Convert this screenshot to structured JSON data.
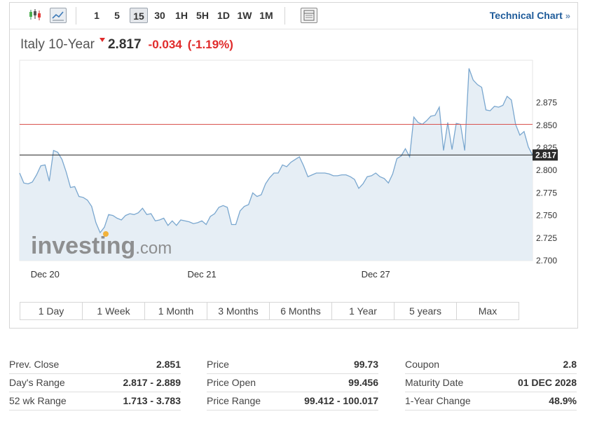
{
  "toolbar": {
    "icons": [
      {
        "name": "candlestick-icon",
        "active": false
      },
      {
        "name": "line-chart-icon",
        "active": true
      }
    ],
    "intervals": [
      {
        "label": "1",
        "active": false
      },
      {
        "label": "5",
        "active": false
      },
      {
        "label": "15",
        "active": true
      },
      {
        "label": "30",
        "active": false
      },
      {
        "label": "1H",
        "active": false
      },
      {
        "label": "5H",
        "active": false
      },
      {
        "label": "1D",
        "active": false
      },
      {
        "label": "1W",
        "active": false
      },
      {
        "label": "1M",
        "active": false
      }
    ],
    "table_icon": "table-icon",
    "technical_chart": "Technical Chart",
    "technical_chev": "»"
  },
  "header": {
    "instrument": "Italy 10-Year",
    "price": "2.817",
    "change": "-0.034",
    "change_pct": "(-1.19%)",
    "direction": "down"
  },
  "colors": {
    "line": "#7aa7cf",
    "area": "#e6eef5",
    "prev_close_line": "#d9534f",
    "current_line": "#222222",
    "negative": "#e02b2b",
    "link": "#1e5b9a"
  },
  "chart_data": {
    "type": "area",
    "y_ticks": [
      2.7,
      2.725,
      2.75,
      2.775,
      2.8,
      2.825,
      2.85,
      2.875
    ],
    "y_tick_labels": [
      "2.700",
      "2.725",
      "2.750",
      "2.775",
      "2.800",
      "2.825",
      "2.850",
      "2.875"
    ],
    "ylim": [
      2.7,
      2.922
    ],
    "x_labels": [
      {
        "label": "Dec 20",
        "index": 6
      },
      {
        "label": "Dec 21",
        "index": 43
      },
      {
        "label": "Dec 27",
        "index": 84
      }
    ],
    "prev_close": 2.851,
    "current": 2.817,
    "current_label": "2.817",
    "values": [
      2.797,
      2.786,
      2.785,
      2.787,
      2.795,
      2.805,
      2.806,
      2.788,
      2.822,
      2.82,
      2.812,
      2.798,
      2.781,
      2.782,
      2.771,
      2.77,
      2.767,
      2.76,
      2.742,
      2.731,
      2.737,
      2.751,
      2.75,
      2.747,
      2.745,
      2.75,
      2.752,
      2.751,
      2.753,
      2.758,
      2.751,
      2.752,
      2.744,
      2.745,
      2.747,
      2.739,
      2.744,
      2.739,
      2.745,
      2.744,
      2.743,
      2.741,
      2.742,
      2.744,
      2.74,
      2.749,
      2.752,
      2.759,
      2.761,
      2.759,
      2.74,
      2.74,
      2.755,
      2.76,
      2.762,
      2.775,
      2.771,
      2.773,
      2.785,
      2.792,
      2.797,
      2.797,
      2.806,
      2.804,
      2.809,
      2.812,
      2.815,
      2.805,
      2.793,
      2.795,
      2.797,
      2.797,
      2.797,
      2.796,
      2.794,
      2.794,
      2.795,
      2.795,
      2.793,
      2.79,
      2.78,
      2.785,
      2.793,
      2.794,
      2.797,
      2.793,
      2.791,
      2.786,
      2.796,
      2.813,
      2.816,
      2.824,
      2.815,
      2.859,
      2.853,
      2.851,
      2.855,
      2.86,
      2.861,
      2.87,
      2.822,
      2.853,
      2.823,
      2.852,
      2.851,
      2.822,
      2.913,
      2.9,
      2.895,
      2.892,
      2.867,
      2.866,
      2.871,
      2.87,
      2.872,
      2.882,
      2.878,
      2.851,
      2.839,
      2.843,
      2.826,
      2.817
    ]
  },
  "watermark": {
    "brand": "investing",
    "suffix": ".com"
  },
  "ranges": [
    "1 Day",
    "1 Week",
    "1 Month",
    "3 Months",
    "6 Months",
    "1 Year",
    "5 years",
    "Max"
  ],
  "stats": [
    [
      {
        "label": "Prev. Close",
        "value": "2.851"
      },
      {
        "label": "Day's Range",
        "value": "2.817 - 2.889"
      },
      {
        "label": "52 wk Range",
        "value": "1.713 - 3.783"
      }
    ],
    [
      {
        "label": "Price",
        "value": "99.73"
      },
      {
        "label": "Price Open",
        "value": "99.456"
      },
      {
        "label": "Price Range",
        "value": "99.412 - 100.017"
      }
    ],
    [
      {
        "label": "Coupon",
        "value": "2.8"
      },
      {
        "label": "Maturity Date",
        "value": "01 DEC 2028"
      },
      {
        "label": "1-Year Change",
        "value": "48.9%"
      }
    ]
  ]
}
